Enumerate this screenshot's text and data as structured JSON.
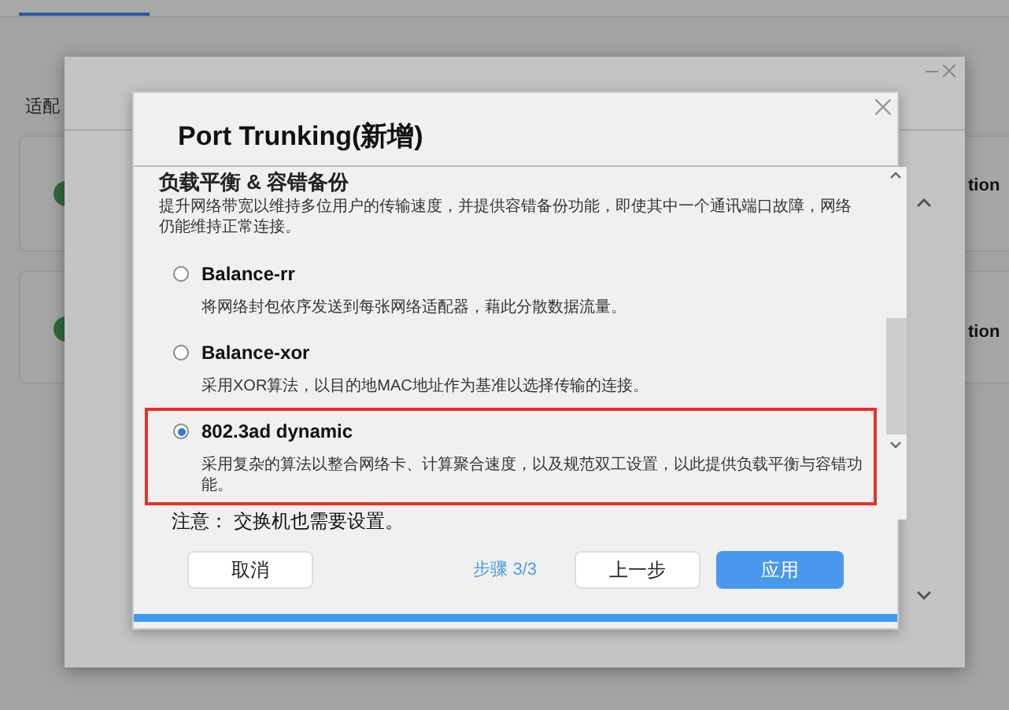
{
  "background": {
    "label": "适配",
    "side_texts": [
      "tion",
      "tion"
    ]
  },
  "dialog": {
    "title": "Port Trunking(新增)",
    "section_title": "负载平衡 & 容错备份",
    "section_text": "提升网络带宽以维持多位用户的传输速度，并提供容错备份功能，即使其中一个通讯端口故障，网络仍能维持正常连接。",
    "options": [
      {
        "label": "Balance-rr",
        "description": "将网络封包依序发送到每张网络适配器，藉此分散数据流量。",
        "selected": false
      },
      {
        "label": "Balance-xor",
        "description": "采用XOR算法，以目的地MAC地址作为基准以选择传输的连接。",
        "selected": false
      },
      {
        "label": "802.3ad dynamic",
        "description": "采用复杂的算法以整合网络卡、计算聚合速度，以及规范双工设置，以此提供负载平衡与容错功能。",
        "selected": true
      }
    ],
    "note": "注意： 交换机也需要设置。",
    "cancel": "取消",
    "step": "步骤 3/3",
    "back": "上一步",
    "apply": "应用",
    "progress": {
      "level": 1
    }
  }
}
